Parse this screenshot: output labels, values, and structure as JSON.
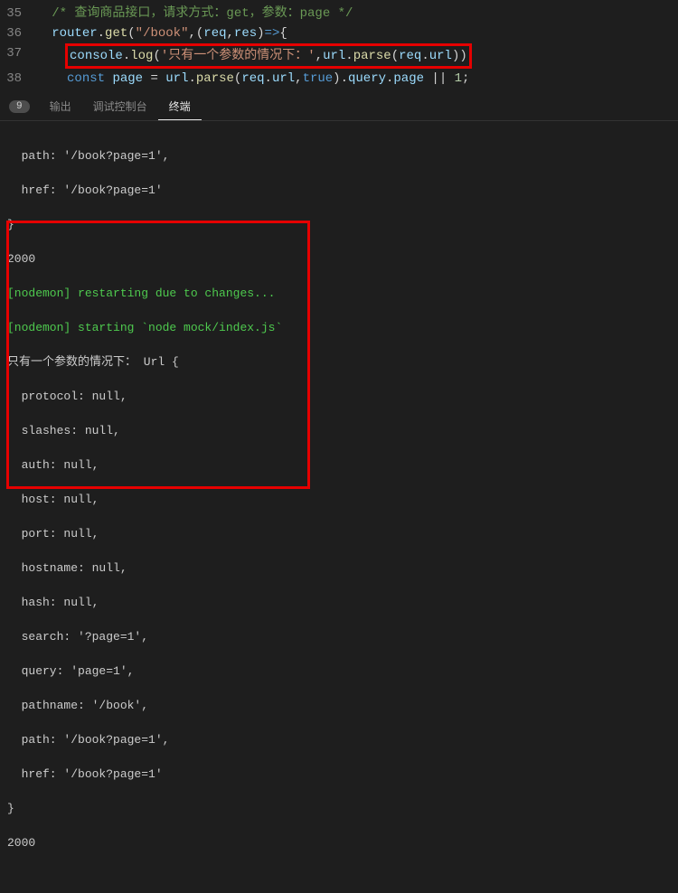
{
  "editor": {
    "lines": [
      {
        "num": "35"
      },
      {
        "num": "36"
      },
      {
        "num": "37"
      },
      {
        "num": "38"
      }
    ],
    "l35_comment": "/* 查询商品接口，请求方式：get，参数：page */",
    "l36_router": "router",
    "l36_get": "get",
    "l36_str_book": "\"/book\"",
    "l36_req": "req",
    "l36_res": "res",
    "l37_console": "console",
    "l37_log": "log",
    "l37_str_msg": "'只有一个参数的情况下：'",
    "l37_url": "url",
    "l37_parse": "parse",
    "l37_reqobj": "req",
    "l37_urlprop": "url",
    "l38_const": "const",
    "l38_page": "page",
    "l38_url": "url",
    "l38_parse": "parse",
    "l38_req": "req",
    "l38_urlprop": "url",
    "l38_true": "true",
    "l38_query": "query",
    "l38_pageprop": "page",
    "l38_one": "1"
  },
  "panel": {
    "badge": "9",
    "tab_output": "输出",
    "tab_debug": "调试控制台",
    "tab_terminal": "终端"
  },
  "terminal": {
    "l1": "  path: '/book?page=1',",
    "l2": "  href: '/book?page=1'",
    "l3": "}",
    "l4": "2000",
    "l5": "[nodemon] restarting due to changes...",
    "l6": "[nodemon] starting `node mock/index.js`",
    "l7": "只有一个参数的情况下： Url {",
    "l8": "  protocol: null,",
    "l9": "  slashes: null,",
    "l10": "  auth: null,",
    "l11": "  host: null,",
    "l12": "  port: null,",
    "l13": "  hostname: null,",
    "l14": "  hash: null,",
    "l15": "  search: '?page=1',",
    "l16": "  query: 'page=1',",
    "l17": "  pathname: '/book',",
    "l18": "  path: '/book?page=1',",
    "l19": "  href: '/book?page=1'",
    "l20": "}",
    "l21": "2000"
  }
}
